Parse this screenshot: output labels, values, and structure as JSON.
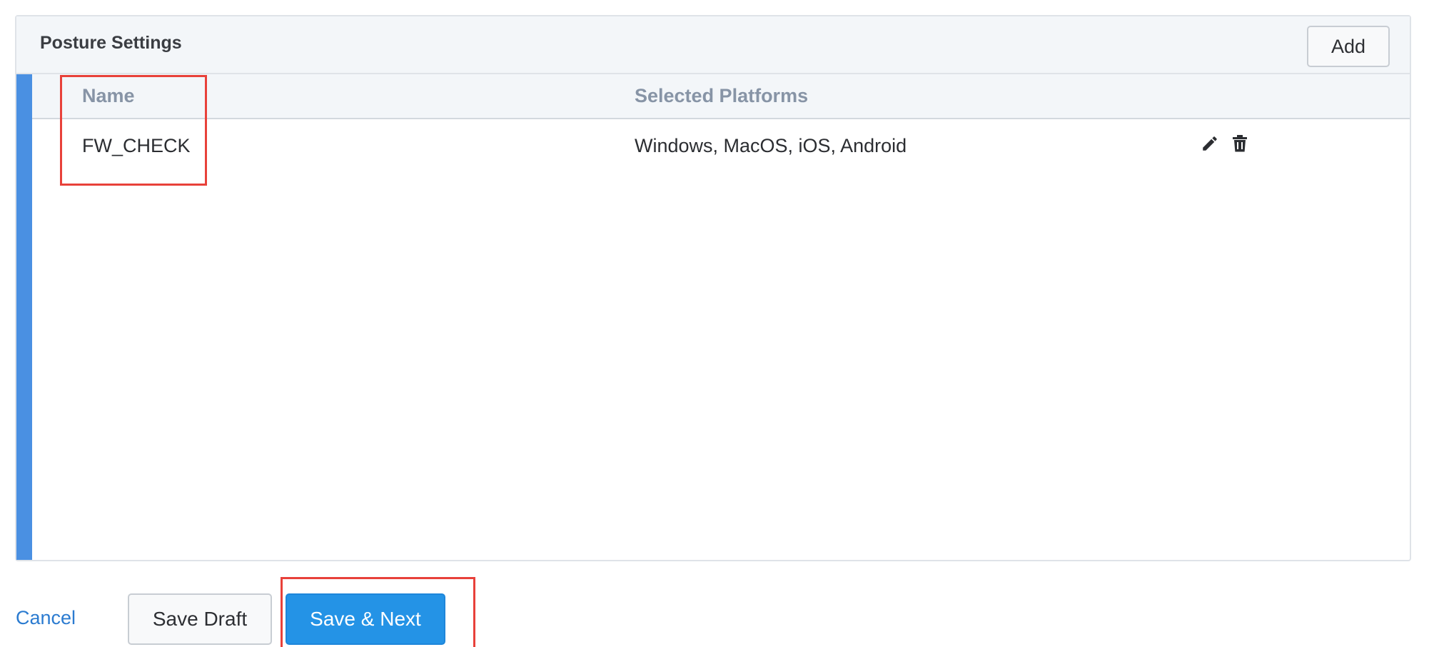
{
  "panel": {
    "title": "Posture Settings",
    "add_label": "Add"
  },
  "table": {
    "columns": [
      "Name",
      "Selected Platforms"
    ],
    "rows": [
      {
        "name": "FW_CHECK",
        "platforms": "Windows, MacOS, iOS, Android",
        "actions": [
          "pencil-icon",
          "trash-icon"
        ]
      }
    ]
  },
  "footer": {
    "cancel_label": "Cancel",
    "save_draft_label": "Save Draft",
    "save_next_label": "Save & Next"
  },
  "colors": {
    "accent": "#4a90e2",
    "primary_button": "#2493e6",
    "link": "#2b7bd0",
    "highlight": "#e8413a"
  }
}
